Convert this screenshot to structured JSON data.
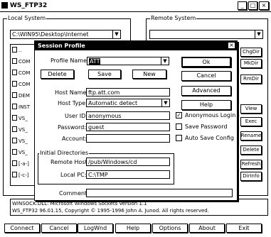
{
  "app": {
    "title": "WS_FTP32",
    "title_buttons": [
      "_",
      "□",
      "×"
    ]
  },
  "local": {
    "group_title": "Local System",
    "path": "C:\\WIN95\\Desktop\\Internet",
    "files": [
      "..",
      "COM",
      "COM",
      "COM",
      "DEM",
      "INST",
      "VS_",
      "VS_",
      "VS_",
      "VS_",
      "[-a-]",
      "[-c-]"
    ]
  },
  "remote": {
    "group_title": "Remote System",
    "path": "",
    "buttons": [
      "ChgDir",
      "MkDir",
      "RmDir",
      "View",
      "Exec",
      "Rename",
      "Delete",
      "Refresh",
      "DirInfo"
    ]
  },
  "log": {
    "line1": "WINSOCK.DLL: Microsoft Windows Sockets Version 1.1",
    "line2": "WS_FTP32 96.01.15, Copyright © 1995-1996 John A. Junod. All rights reserved."
  },
  "bottom_buttons": [
    "Connect",
    "Cancel",
    "LogWnd",
    "Help",
    "Options",
    "About",
    "Exit"
  ],
  "dialog": {
    "title": "Session Profile",
    "close": "×",
    "profile_name_label": "Profile Name:",
    "profile_name_value": "ATT",
    "delete_label": "Delete",
    "save_label": "Save",
    "new_label": "New",
    "host_name_label": "Host Name:",
    "host_name_value": "ftp.att.com",
    "host_type_label": "Host Type:",
    "host_type_value": "Automatic detect",
    "user_id_label": "User ID:",
    "user_id_value": "anonymous",
    "password_label": "Password:",
    "password_value": "guest",
    "account_label": "Account:",
    "account_value": "",
    "anonymous_label": "Anonymous Login",
    "anonymous_checked": true,
    "save_password_label": "Save Password",
    "save_password_checked": false,
    "auto_save_label": "Auto Save Config",
    "auto_save_checked": false,
    "ok_label": "Ok",
    "cancel_label": "Cancel",
    "advanced_label": "Advanced",
    "help_label": "Help",
    "init_dirs_title": "Initial Directories",
    "remote_host_label": "Remote Host:",
    "remote_host_value": "/pub/Windows/cd",
    "local_pc_label": "Local PC:",
    "local_pc_value": "C:\\TMP",
    "comment_label": "Comment:",
    "comment_value": ""
  }
}
